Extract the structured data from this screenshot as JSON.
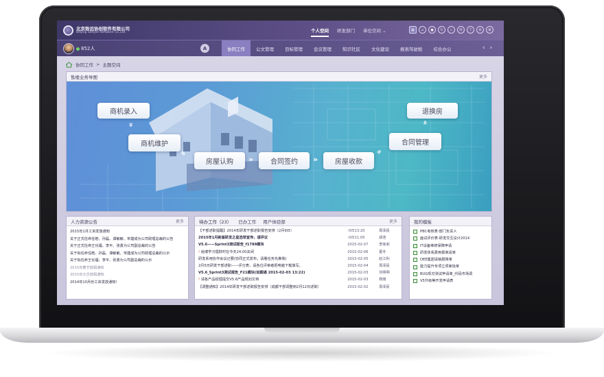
{
  "company": {
    "name_cn": "北京致远协创软件有限公司",
    "name_en": "Beijing Seeyon software Co.,Ltd."
  },
  "top_nav": {
    "items": [
      "个人空间",
      "研发部门",
      "单位空间"
    ],
    "active_index": 0,
    "dropdown_icon": "chevron-down-icon"
  },
  "top_icons": [
    "grid-icon",
    "home-icon",
    "user-icon",
    "refresh-icon",
    "search-icon",
    "mail-icon",
    "help-icon",
    "a-icon",
    "settings-icon"
  ],
  "user": {
    "online_count": "852人",
    "status_color": "#6cd36a",
    "font_badge": "A"
  },
  "module_tabs": {
    "items": [
      "协同工作",
      "公文管理",
      "目标管理",
      "会议管理",
      "知识社区",
      "文化建设",
      "报表驾驶舱",
      "综合办公"
    ],
    "active_index": 0,
    "prev": "‹",
    "next": "›"
  },
  "breadcrumb": {
    "root": "协同工作",
    "separator": ">",
    "current": "主题空间"
  },
  "banner_panel": {
    "title": "售楼业务导图",
    "more": "更多",
    "flow": [
      "商机录入",
      "商机维护",
      "房屋认购",
      "合同签约",
      "房屋收款",
      "合同管理",
      "退换房"
    ]
  },
  "hr_panel": {
    "title": "人力资源公告",
    "more": "更多",
    "items": [
      {
        "text": "2015年1月工资发放通知",
        "dim": false
      },
      {
        "text": "关于正式任命任皓、孙磊、谭敏敏、宋建成为公司助理总裁的公告",
        "dim": false
      },
      {
        "text": "关于正式任命王化福、李平、张勇为公司副总裁的公告",
        "dim": false
      },
      {
        "text": "关于拟任命任皓、孙磊、谭敏敏、宋建成为公司助理总裁的公示",
        "dim": false
      },
      {
        "text": "关于拟任命王化福、李平、张勇为公司副总裁的公示",
        "dim": false
      },
      {
        "text": "2015年春节放假通知",
        "dim": true
      },
      {
        "text": "2015年元旦放假通知",
        "dim": true
      },
      {
        "text": "2014年10月份工资发放通知！",
        "dim": false
      }
    ]
  },
  "todo_panel": {
    "tabs": [
      "待办工作（23）",
      "已办工作",
      "用户体验部"
    ],
    "more": "更多",
    "rows": [
      {
        "title": "【干部述职提醒】2014年研发干部述职报告安排（2月9日）",
        "date": "-0日13:20",
        "person": "周泽民",
        "flag": ""
      },
      {
        "title": "2015年1月新版研发之星选举宣传，请评议",
        "date": "-0日11:05",
        "person": "胡浩",
        "flag": "bold"
      },
      {
        "title": "V5.6——Sprint3测试报告_f1789模块",
        "date": "2015-02-07",
        "person": "李家莉",
        "flag": "bold"
      },
      {
        "title": "给博学习理财时在今天24:00关闭",
        "date": "2015-02-06",
        "person": "夏冬",
        "flag": "red"
      },
      {
        "title": "研发系用协作会议记要(协同正式发布，请看任务先推我)",
        "date": "2015-02-05",
        "person": "赵江利",
        "flag": ""
      },
      {
        "title": "2月5日研发干部述职——评分表，请各位评审者把电脑下载填写。",
        "date": "2015-02-04",
        "person": "周泽民",
        "flag": ""
      },
      {
        "title": "V5.6_Sprint3测试报告_F21模块(如期通 2015-02-03 13:22)",
        "date": "2015-02-03",
        "person": "刘明明",
        "flag": "bold"
      },
      {
        "title": "请各产品经理提交V5.6产品规划文档",
        "date": "2015-02-03",
        "person": "杨丽",
        "flag": "red"
      },
      {
        "title": "【调整通知】2014年研发干部述职报告安排（成都干部调整到2月12日述职）",
        "date": "2015-02-02",
        "person": "周泽民",
        "flag": ""
      }
    ]
  },
  "template_panel": {
    "title": "我的模板",
    "items": [
      "PBC考核表-部门负责人",
      "面试评价表-研发交互设计2014",
      "IT设备维修保障申请",
      "研发体系费用报单请单",
      "DEE集团请销报障单",
      "能力提升专项立项审批单",
      "BUG现交测试申请单_代码市场调",
      "V5升级等开发申请表"
    ]
  }
}
